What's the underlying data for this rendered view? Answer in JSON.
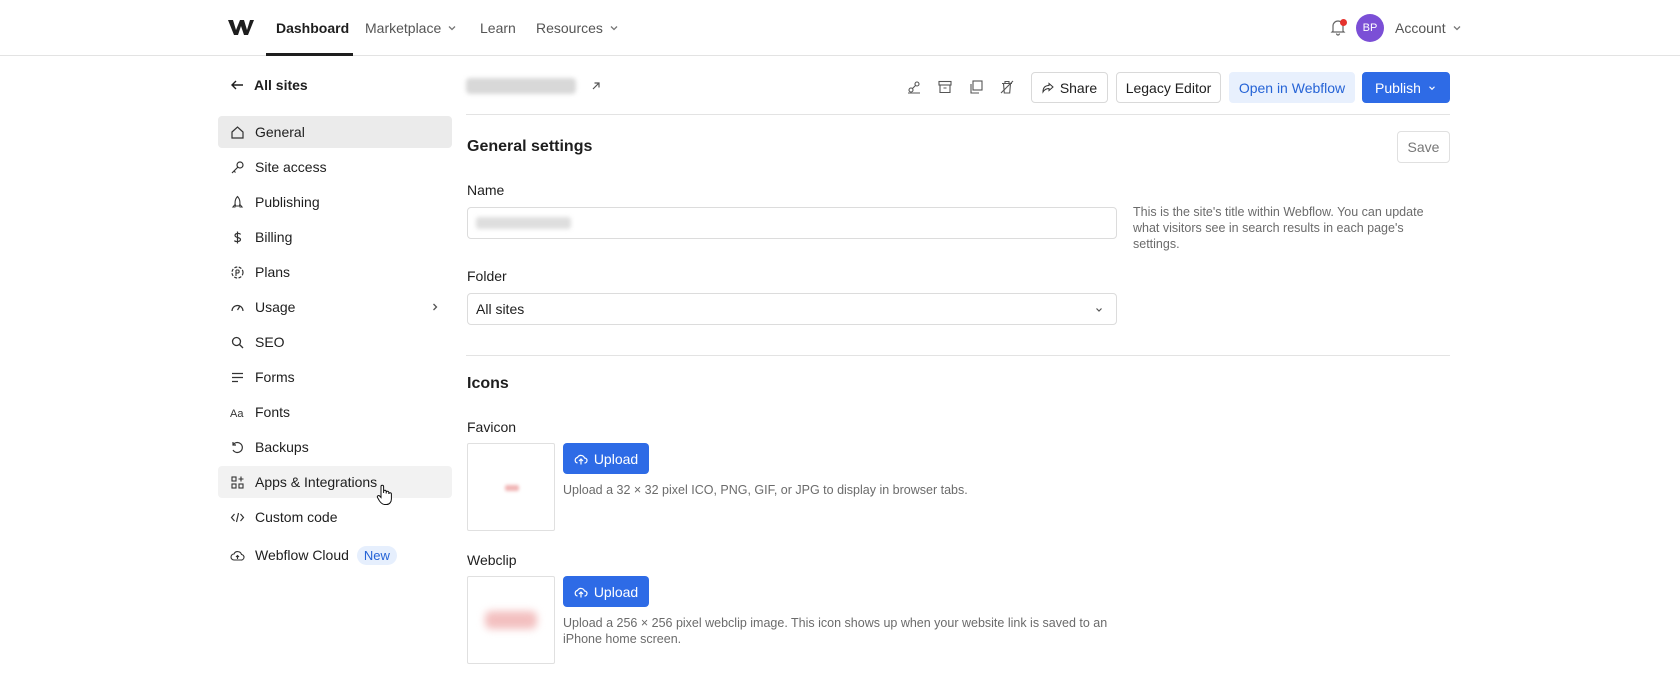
{
  "topnav": {
    "items": [
      {
        "label": "Dashboard",
        "active": true
      },
      {
        "label": "Marketplace",
        "has_menu": true
      },
      {
        "label": "Learn"
      },
      {
        "label": "Resources",
        "has_menu": true
      }
    ],
    "avatar_initials": "BP",
    "account_label": "Account",
    "notification_dot_color": "#e5322d",
    "avatar_color": "#7b4fd6"
  },
  "sidebar": {
    "back_label": "All sites",
    "items": [
      {
        "label": "General",
        "icon": "home-icon",
        "active": true
      },
      {
        "label": "Site access",
        "icon": "key-icon"
      },
      {
        "label": "Publishing",
        "icon": "rocket-icon"
      },
      {
        "label": "Billing",
        "icon": "dollar-icon"
      },
      {
        "label": "Plans",
        "icon": "plans-icon"
      },
      {
        "label": "Usage",
        "icon": "gauge-icon",
        "has_submenu": true
      },
      {
        "label": "SEO",
        "icon": "search-icon"
      },
      {
        "label": "Forms",
        "icon": "forms-icon"
      },
      {
        "label": "Fonts",
        "icon": "fonts-icon"
      },
      {
        "label": "Backups",
        "icon": "backup-icon"
      },
      {
        "label": "Apps & Integrations",
        "icon": "apps-icon",
        "hovered": true
      },
      {
        "label": "Custom code",
        "icon": "code-icon"
      },
      {
        "label": "Webflow Cloud",
        "icon": "cloud-icon",
        "badge": "New"
      }
    ]
  },
  "toolbar": {
    "share_label": "Share",
    "legacy_editor_label": "Legacy Editor",
    "open_label": "Open in Webflow",
    "publish_label": "Publish",
    "accent": "#2e6be6"
  },
  "general": {
    "title": "General settings",
    "save_label": "Save",
    "name_label": "Name",
    "name_help": "This is the site's title within Webflow. You can update what visitors see in search results in each page's settings.",
    "folder_label": "Folder",
    "folder_value": "All sites"
  },
  "icons": {
    "title": "Icons",
    "favicon_label": "Favicon",
    "favicon_upload": "Upload",
    "favicon_desc": "Upload a 32 × 32 pixel ICO, PNG, GIF, or JPG to display in browser tabs.",
    "webclip_label": "Webclip",
    "webclip_upload": "Upload",
    "webclip_desc": "Upload a 256 × 256 pixel webclip image. This icon shows up when your website link is saved to an iPhone home screen."
  }
}
